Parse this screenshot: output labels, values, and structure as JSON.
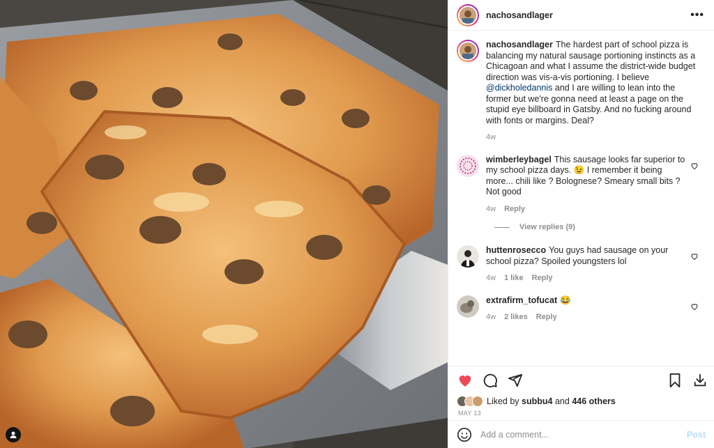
{
  "post": {
    "author": "nachosandlager",
    "more_label": "•••",
    "caption": {
      "username": "nachosandlager",
      "text_before": "The hardest part of school pizza is balancing my natural sausage portioning instincts as a Chicagoan and what I assume the district-wide budget direction was vis-a-vis portioning. I believe ",
      "mention": "@dickholedannis",
      "text_after": " and I are willing to lean into the former but we're gonna need at least a page on the stupid eye billboard in Gatsby. And no fucking around with fonts or margins. Deal?",
      "time": "4w"
    },
    "comments": [
      {
        "username": "wimberleybagel",
        "text": "This sausage looks far superior to my school pizza days. 😉 I remember it being more... chili like ? Bolognese? Smeary small bits ? Not good",
        "time": "4w",
        "likes": "",
        "reply": "Reply"
      },
      {
        "username": "huttenrosecco",
        "text": "You guys had sausage on your school pizza? Spoiled youngsters lol",
        "time": "4w",
        "likes": "1 like",
        "reply": "Reply"
      },
      {
        "username": "extrafirm_tofucat",
        "text": "😂",
        "time": "4w",
        "likes": "2 likes",
        "reply": "Reply"
      }
    ],
    "view_replies": "View replies (9)",
    "liked_by": {
      "prefix": "Liked by ",
      "user": "subbu4",
      "middle": " and ",
      "count": "446 others"
    },
    "date": "MAY 13",
    "comment_placeholder": "Add a comment...",
    "post_button": "Post"
  },
  "colors": {
    "like_red": "#ed4956",
    "mention": "#00376b",
    "post_disabled": "#b2dffc"
  },
  "icons": [
    "heart-filled-icon",
    "comment-icon",
    "share-icon",
    "bookmark-icon",
    "download-icon",
    "emoji-icon",
    "more-icon",
    "user-tag-icon",
    "heart-outline-icon"
  ]
}
